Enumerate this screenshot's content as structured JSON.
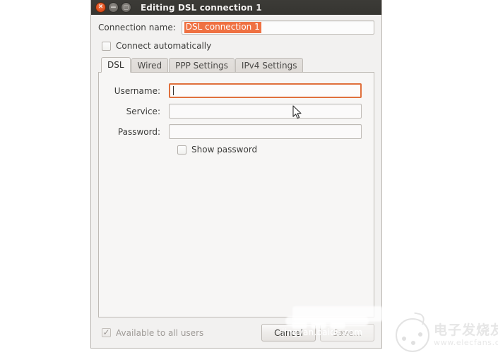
{
  "window": {
    "title": "Editing DSL connection 1",
    "controls": {
      "close": {
        "name": "close-icon",
        "glyph": "×"
      },
      "minimize": {
        "name": "minimize-icon",
        "glyph": "−"
      },
      "maximize": {
        "name": "maximize-icon",
        "glyph": "□"
      }
    }
  },
  "connection": {
    "name_label": "Connection name:",
    "name_value": "DSL connection 1",
    "name_selected": true,
    "auto_connect_label": "Connect automatically",
    "auto_connect_checked": false
  },
  "tabs": [
    {
      "label": "DSL",
      "active": true
    },
    {
      "label": "Wired",
      "active": false
    },
    {
      "label": "PPP Settings",
      "active": false
    },
    {
      "label": "IPv4 Settings",
      "active": false
    }
  ],
  "dsl_tab": {
    "fields": [
      {
        "label": "Username:",
        "value": "",
        "focused": true
      },
      {
        "label": "Service:",
        "value": "",
        "focused": false
      },
      {
        "label": "Password:",
        "value": "",
        "focused": false
      }
    ],
    "show_password_label": "Show password",
    "show_password_checked": false
  },
  "footer": {
    "available_all_users_label": "Available to all users",
    "available_all_users_checked": true,
    "available_all_users_disabled": true,
    "cancel_label": "Cancel",
    "save_label": "Save...",
    "save_disabled": true
  },
  "watermarks": {
    "baidu": "jingyan.baidu.com",
    "elecfans_cn": "电子发烧友",
    "elecfans_url": "www.elecfans.com"
  },
  "colors": {
    "accent_orange": "#dd4814",
    "selection_orange": "#ef7142",
    "focus_border": "#e0703c",
    "titlebar": "#3c3b37",
    "dialog_bg": "#f2f1f0",
    "panel_bg": "#f7f6f5"
  }
}
